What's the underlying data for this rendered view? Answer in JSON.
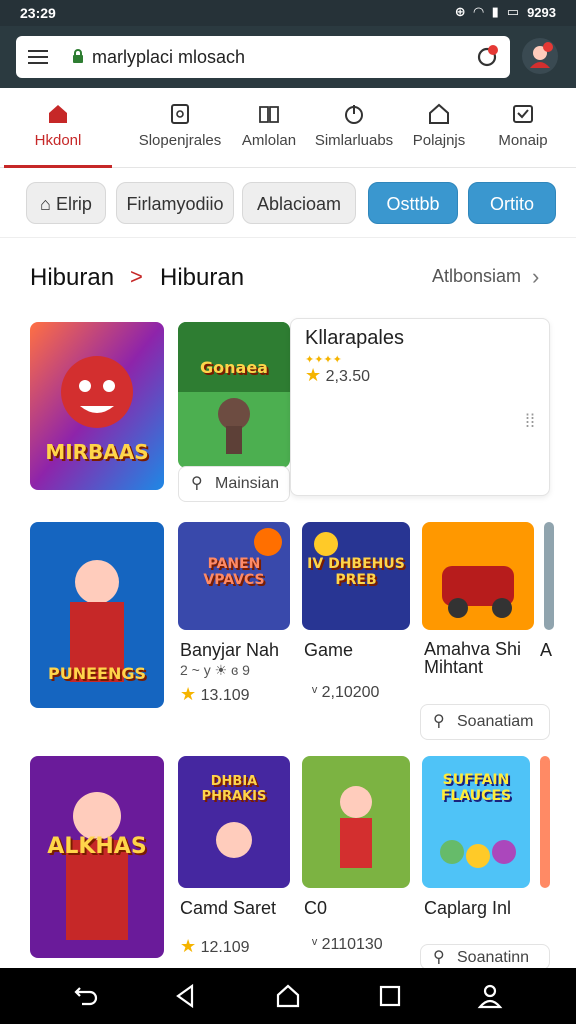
{
  "status": {
    "time": "23:29",
    "right_text": "9293"
  },
  "browser": {
    "url": "marlyplaci mlosach",
    "badge_color": "#e53935"
  },
  "tabs": [
    {
      "label": "Hkdonl",
      "icon": "home-icon",
      "active": true
    },
    {
      "label": "Slopenjrales",
      "icon": "tablet-icon"
    },
    {
      "label": "Amlolan",
      "icon": "book-icon"
    },
    {
      "label": "Simlarluabs",
      "icon": "power-icon"
    },
    {
      "label": "Polajnjs",
      "icon": "house-outline-icon"
    },
    {
      "label": "Monaip",
      "icon": "inbox-icon"
    }
  ],
  "chips": [
    {
      "label": "Elrip",
      "icon": "store-icon",
      "style": "grey"
    },
    {
      "label": "Firlamyodiio",
      "style": "grey"
    },
    {
      "label": "Ablacioam",
      "style": "grey"
    },
    {
      "label": "Osttbb",
      "style": "blue"
    },
    {
      "label": "Ortito",
      "style": "blue"
    }
  ],
  "section": {
    "crumb1": "Hiburan",
    "separator": ">",
    "crumb2": "Hiburan",
    "see_all": "Atlbonsiam",
    "see_all_chevron": "›"
  },
  "row1": {
    "card1": {
      "logo": "MIRBAAS"
    },
    "card2": {
      "logo": "Gonaea",
      "meta": "Mainsian"
    },
    "popup": {
      "title": "Kllarapales",
      "stars": "✦✦✦✦",
      "rating": "2,3.50"
    }
  },
  "row2": [
    {
      "logo": "PUNEENGS",
      "title": "",
      "sub": "",
      "rating": ""
    },
    {
      "logo": "PANEN VPAVCS",
      "title": "Banyjar Nah",
      "sub": "2 ~ y ☀ ɞ 9",
      "rating": "13.109"
    },
    {
      "logo": "IV DHBEHUS PREB",
      "title": "Game",
      "sub": "",
      "rating": "2,10200",
      "rating_prefix": "ᵛ"
    },
    {
      "logo": "",
      "title": "Amahva Shi Mihtant",
      "sub": "",
      "rating": ""
    },
    {
      "title": "A"
    }
  ],
  "row2_meta": "Soanatiam",
  "row3": [
    {
      "logo": "ALKHAS",
      "title": "",
      "rating": ""
    },
    {
      "logo": "DHBIA PHRAKIS",
      "title": "Camd Saret",
      "rating": "12.109"
    },
    {
      "logo": "",
      "title": "C0",
      "rating": "2110130",
      "rating_prefix": "ᵛ"
    },
    {
      "logo": "SUFFAIN FLAUCES",
      "title": "Caplarg Inl",
      "rating": ""
    }
  ],
  "row3_meta": "Soanatinn",
  "colors": {
    "accent_red": "#c62828",
    "chip_blue": "#3a97cf",
    "star": "#f5b400"
  }
}
